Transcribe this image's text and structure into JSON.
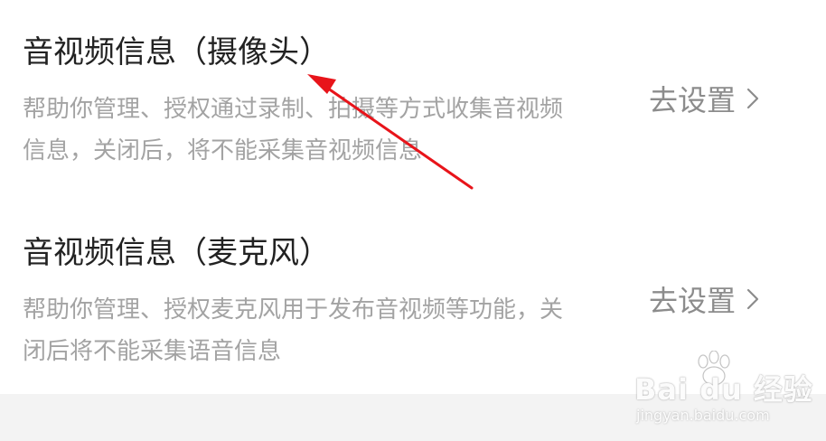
{
  "settings": {
    "items": [
      {
        "title": "音视频信息（摄像头）",
        "description_lines": [
          "帮助你管理、授权通过录制、拍摄等方式收集音视频",
          "信息，关闭后，将不能采集音视频信息"
        ],
        "action_label": "去设置"
      },
      {
        "title": "音视频信息（麦克风）",
        "description_lines": [
          "帮助你管理、授权麦克风用于发布音视频等功能，关",
          "闭后将不能采集语音信息"
        ],
        "action_label": "去设置"
      }
    ]
  },
  "annotation": {
    "arrow_color": "#e8141a"
  },
  "watermark": {
    "logo": "Bai du 经验",
    "url": "jingyan.baidu.com"
  }
}
